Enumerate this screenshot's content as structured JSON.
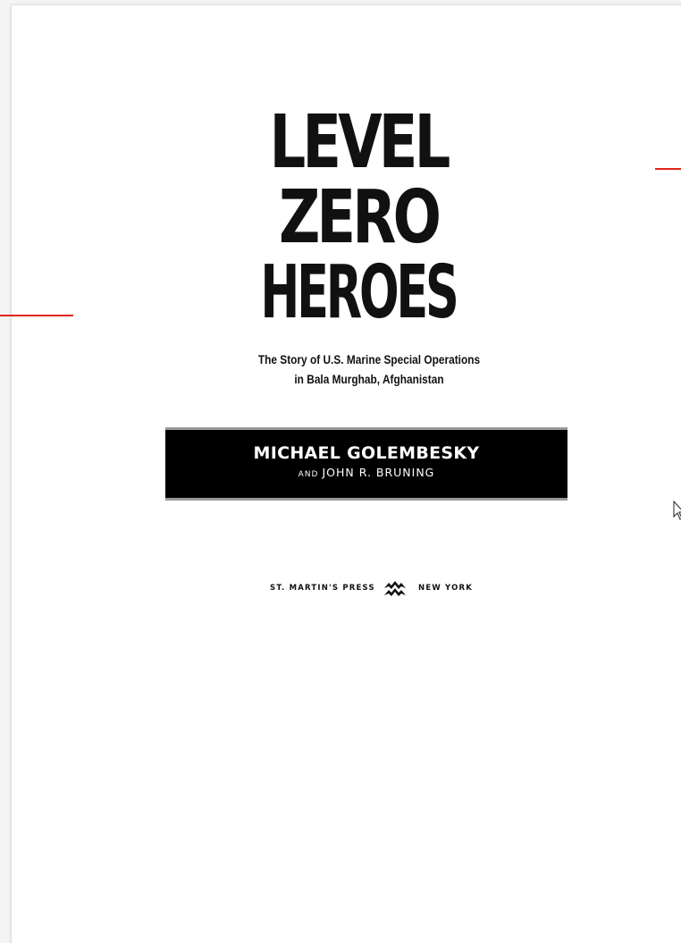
{
  "book": {
    "title_lines": [
      "LEVEL",
      "ZERO",
      "HEROES"
    ],
    "subtitle_lines": [
      "The Story of U.S. Marine Special Operations",
      "in Bala Murghab, Afghanistan"
    ],
    "author_primary": "MICHAEL GOLEMBESKY",
    "author_conjunction": "AND",
    "author_secondary": "JOHN R. BRUNING",
    "publisher": "ST. MARTIN'S PRESS",
    "city": "NEW YORK",
    "publisher_logo_icon": "st-martins-press-logo-icon"
  },
  "colors": {
    "page": "#ffffff",
    "viewer_background": "#f4f4f4",
    "ink": "#111111",
    "author_band": "#000000",
    "marker": "#e0251c"
  },
  "overlay": {
    "cursor_icon": "arrow-cursor-icon"
  }
}
